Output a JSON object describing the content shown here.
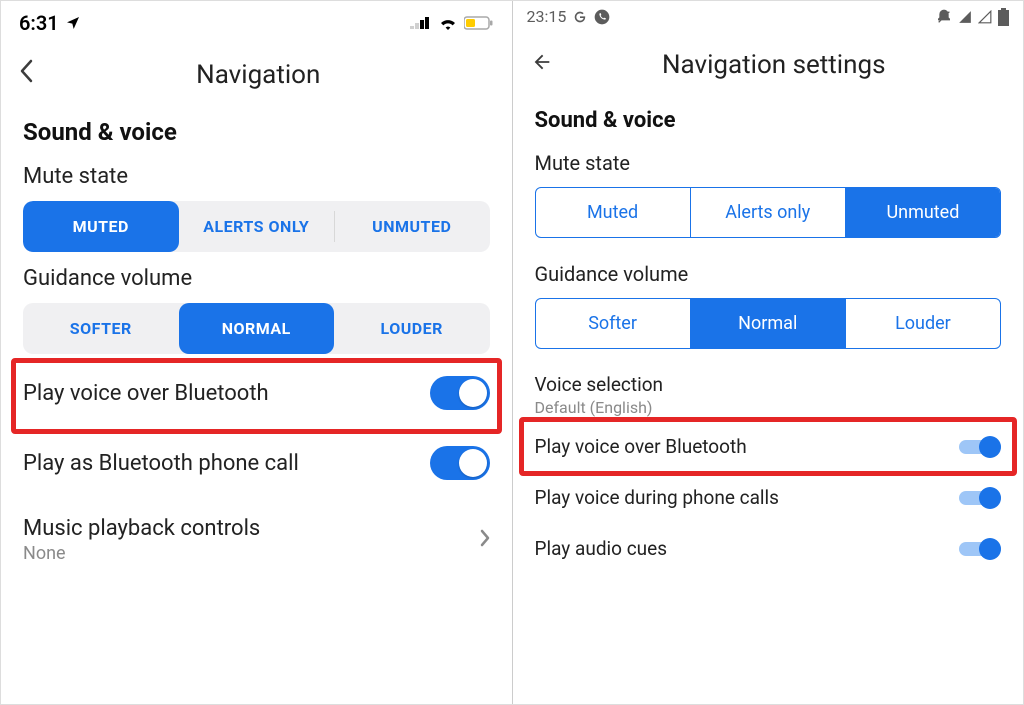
{
  "left": {
    "status": {
      "time": "6:31",
      "location_icon": "location"
    },
    "header": {
      "title": "Navigation"
    },
    "section": "Sound & voice",
    "mute_state": {
      "label": "Mute state",
      "options": [
        "MUTED",
        "ALERTS ONLY",
        "UNMUTED"
      ],
      "selected": 0
    },
    "guidance_volume": {
      "label": "Guidance volume",
      "options": [
        "SOFTER",
        "NORMAL",
        "LOUDER"
      ],
      "selected": 1
    },
    "rows": {
      "play_bt": {
        "label": "Play voice over Bluetooth",
        "on": true,
        "highlight": true
      },
      "play_bt_call": {
        "label": "Play as Bluetooth phone call",
        "on": true
      },
      "music": {
        "label": "Music playback controls",
        "sub": "None"
      }
    }
  },
  "right": {
    "status": {
      "time": "23:15"
    },
    "header": {
      "title": "Navigation settings"
    },
    "section": "Sound & voice",
    "mute_state": {
      "label": "Mute state",
      "options": [
        "Muted",
        "Alerts only",
        "Unmuted"
      ],
      "selected": 2
    },
    "guidance_volume": {
      "label": "Guidance volume",
      "options": [
        "Softer",
        "Normal",
        "Louder"
      ],
      "selected": 1
    },
    "voice_selection": {
      "label": "Voice selection",
      "value": "Default (English)"
    },
    "rows": {
      "play_bt": {
        "label": "Play voice over Bluetooth",
        "on": true,
        "highlight": true
      },
      "play_calls": {
        "label": "Play voice during phone calls",
        "on": true
      },
      "audio_cues": {
        "label": "Play audio cues",
        "on": true
      }
    }
  }
}
